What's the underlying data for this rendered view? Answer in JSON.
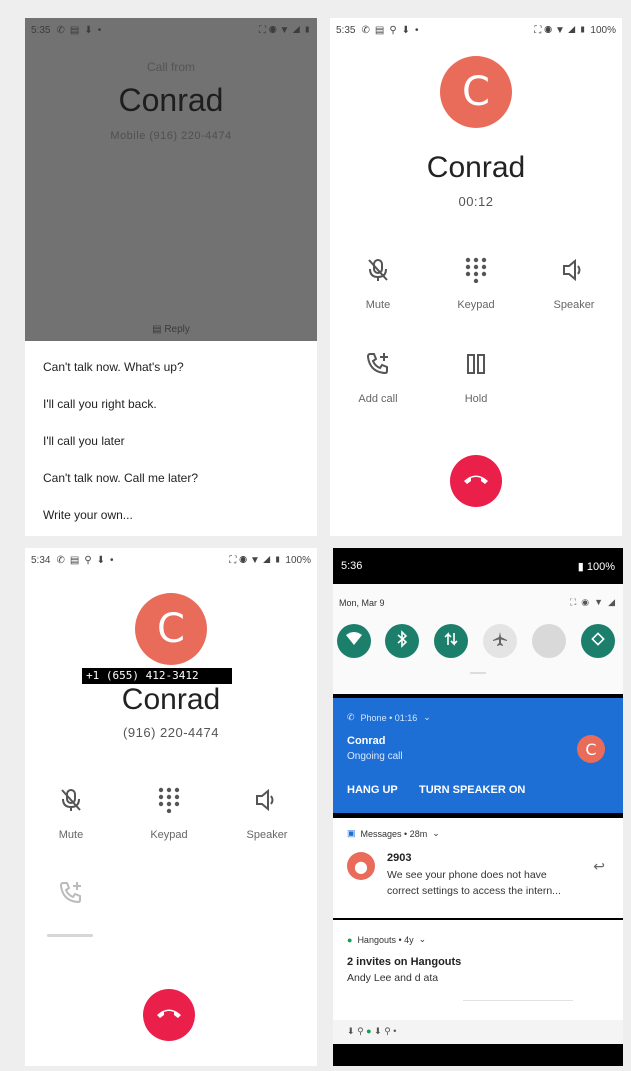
{
  "panel1": {
    "status_time": "5:35",
    "call_from": "Call from",
    "caller_name": "Conrad",
    "caller_line": "Mobile (916) 220-4474",
    "reply_label": "Reply",
    "replies": [
      "Can't talk now. What's up?",
      "I'll call you right back.",
      "I'll call you later",
      "Can't talk now. Call me later?",
      "Write your own..."
    ]
  },
  "panel2": {
    "status_time": "5:35",
    "battery": "100%",
    "avatar_letter": "C",
    "caller_name": "Conrad",
    "timer": "00:12",
    "controls": [
      {
        "label": "Mute",
        "icon": "mic-off-icon"
      },
      {
        "label": "Keypad",
        "icon": "dialpad-icon"
      },
      {
        "label": "Speaker",
        "icon": "speaker-icon"
      },
      {
        "label": "Add call",
        "icon": "add-call-icon"
      },
      {
        "label": "Hold",
        "icon": "pause-icon"
      }
    ]
  },
  "panel3": {
    "status_time": "5:34",
    "battery": "100%",
    "avatar_letter": "C",
    "masked_number": "+1 (655) 412-3412",
    "caller_name": "Conrad",
    "caller_number": "(916) 220-4474",
    "controls": [
      {
        "label": "Mute",
        "icon": "mic-off-icon"
      },
      {
        "label": "Keypad",
        "icon": "dialpad-icon"
      },
      {
        "label": "Speaker",
        "icon": "speaker-icon"
      }
    ]
  },
  "panel4": {
    "status_time": "5:36",
    "battery": "100%",
    "date": "Mon, Mar 9",
    "phone_notification": {
      "app": "Phone • 01:16",
      "title": "Conrad",
      "subtitle": "Ongoing call",
      "avatar_letter": "C",
      "action_hang_up": "HANG UP",
      "action_speaker": "TURN SPEAKER ON"
    },
    "messages_notification": {
      "app": "Messages • 28m",
      "sender": "2903",
      "line1": "We see your phone does not have",
      "line2": "correct settings to access the intern..."
    },
    "hangouts_notification": {
      "app": "Hangouts • 4y",
      "title": "2 invites on Hangouts",
      "text": "Andy Lee and d ata"
    }
  },
  "colors": {
    "avatar": "#e96c5a",
    "end_call": "#ea1f4a",
    "phone_notification": "#1d6fd6",
    "quick_tile_on": "#1b7f6c"
  }
}
